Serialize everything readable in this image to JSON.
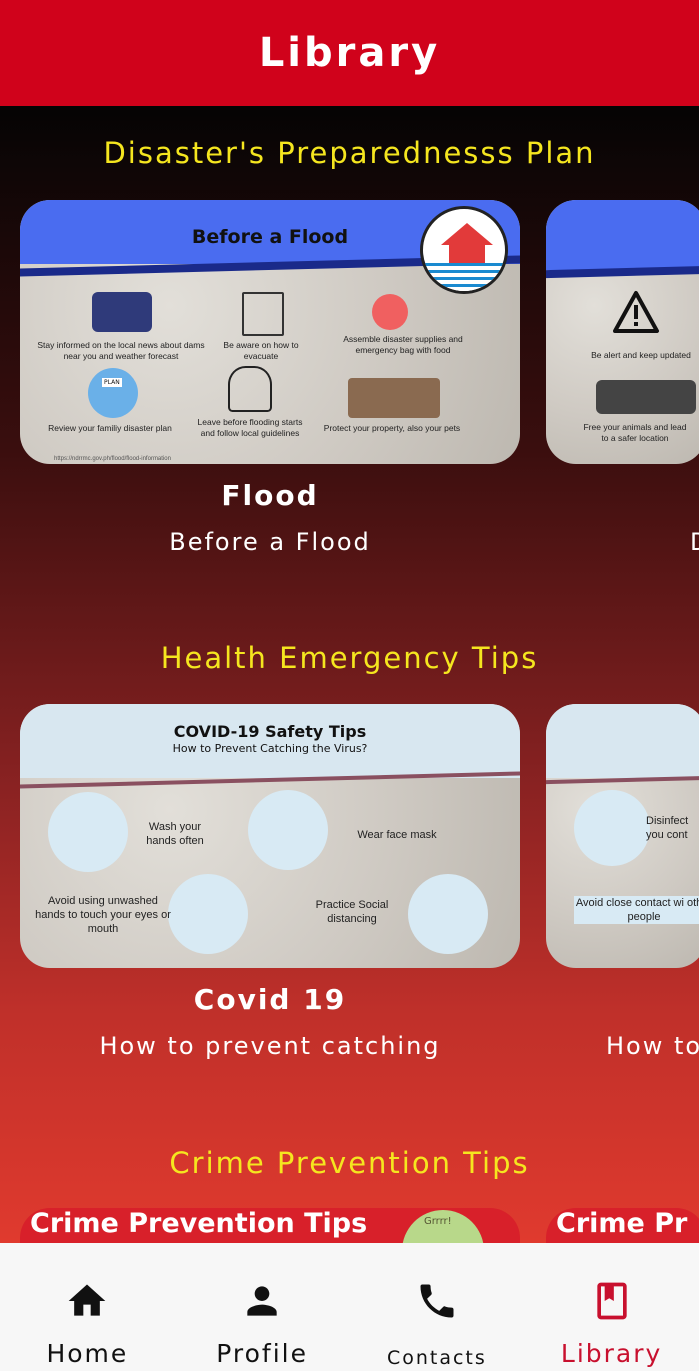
{
  "header": {
    "title": "Library"
  },
  "sections": [
    {
      "title": "Disaster's Preparednesss Plan",
      "cards": [
        {
          "title": "Flood",
          "subtitle": "Before a Flood",
          "image": {
            "heading": "Before a Flood",
            "tips": [
              "Stay informed on the local news about dams near you and weather forecast",
              "Be aware on how to evacuate",
              "Assemble disaster supplies and emergency bag with food",
              "Review your familiy disaster plan",
              "Leave before flooding starts and follow local guidelines",
              "Protect your property, also your pets"
            ],
            "source": "https://ndrrmc.gov.ph/flood/flood-information",
            "plan_label": "PLAN"
          }
        },
        {
          "title": "",
          "subtitle": "D",
          "image": {
            "tips": [
              "Be alert and keep updated",
              "Free your animals and lead to a safer location"
            ]
          }
        }
      ]
    },
    {
      "title": "Health Emergency Tips",
      "cards": [
        {
          "title": "Covid 19",
          "subtitle": "How to prevent catching",
          "image": {
            "heading": "COVID-19 Safety Tips",
            "subheading": "How to Prevent Catching the Virus?",
            "tips": [
              "Wash your hands often",
              "Wear face mask",
              "Avoid using unwashed hands to touch your eyes or mouth",
              "Practice Social distancing"
            ]
          }
        },
        {
          "title": "",
          "subtitle": "How to",
          "image": {
            "tips": [
              "Disinfect you cont",
              "Avoid close contact wi other people"
            ]
          }
        }
      ]
    },
    {
      "title": "Crime Prevention Tips",
      "cards": [
        {
          "image": {
            "heading": "Crime Prevention Tips",
            "badge_text": "Grrrr!"
          }
        },
        {
          "image": {
            "heading": "Crime Pr"
          }
        }
      ]
    }
  ],
  "nav": {
    "items": [
      {
        "label": "Home",
        "icon": "home-icon"
      },
      {
        "label": "Profile",
        "icon": "person-icon"
      },
      {
        "label": "Contacts",
        "icon": "phone-icon"
      },
      {
        "label": "Library",
        "icon": "bookmark-book-icon",
        "active": true
      }
    ]
  },
  "colors": {
    "primary": "#d0021b",
    "section_title": "#f5e61f",
    "active_nav": "#c8102e"
  }
}
